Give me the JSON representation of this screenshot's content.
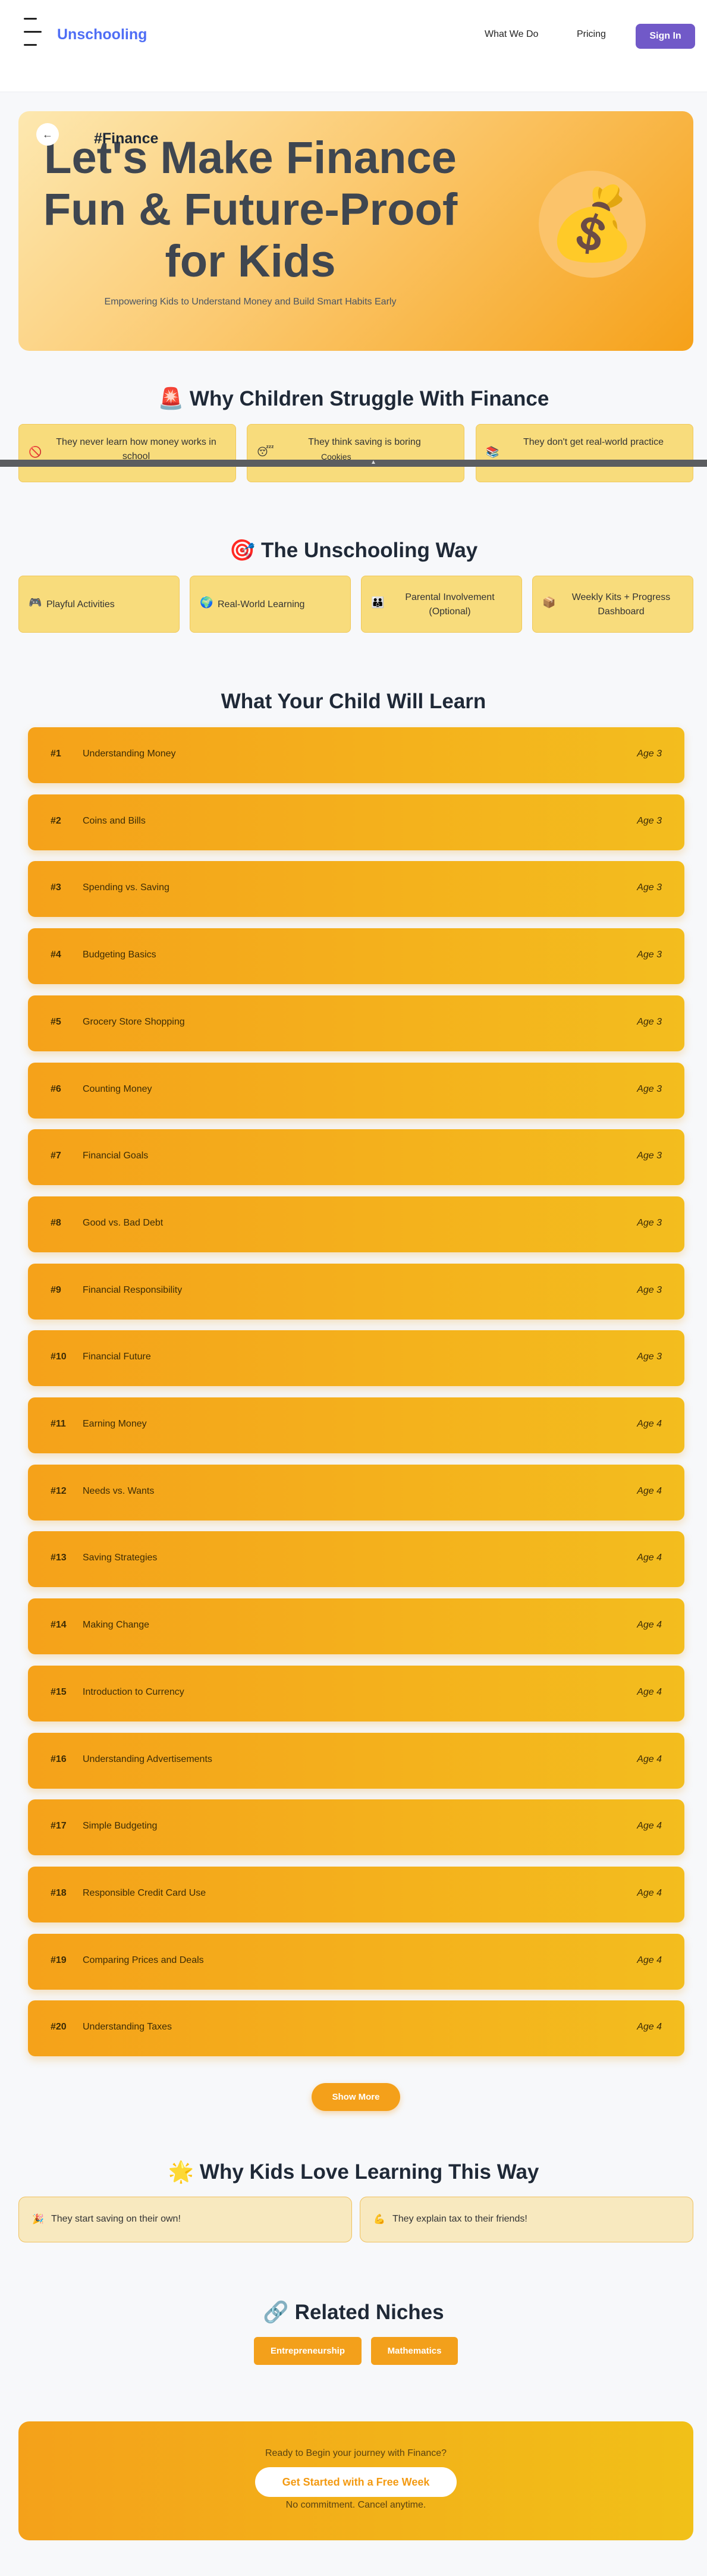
{
  "nav": {
    "brand": "Unschooling",
    "links": [
      "What We Do",
      "Pricing"
    ],
    "signin": "Sign In"
  },
  "hero": {
    "back_icon": "←",
    "tag": "#Finance",
    "title": "Let's Make Finance Fun & Future-Proof for Kids",
    "subtitle": "Empowering Kids to Understand Money and Build Smart Habits Early",
    "icon": "💰"
  },
  "struggle": {
    "title": "🚨 Why Children Struggle With Finance",
    "items": [
      {
        "icon": "🚫",
        "text": "They never learn how money works in school"
      },
      {
        "icon": "😴",
        "text": "They think saving is boring"
      },
      {
        "icon": "📚",
        "text": "They don't get real-world practice"
      }
    ]
  },
  "cookie": {
    "label": "Cookies",
    "chevron": "▲"
  },
  "way": {
    "title": "🎯 The Unschooling Way",
    "items": [
      {
        "icon": "🎮",
        "text": "Playful Activities"
      },
      {
        "icon": "🌍",
        "text": "Real-World Learning"
      },
      {
        "icon": "👪",
        "text": "Parental Involvement (Optional)"
      },
      {
        "icon": "📦",
        "text": "Weekly Kits + Progress Dashboard"
      }
    ]
  },
  "learn": {
    "title": "What Your Child Will Learn",
    "lessons": [
      {
        "num": "#1",
        "name": "Understanding Money",
        "age": "Age 3"
      },
      {
        "num": "#2",
        "name": "Coins and Bills",
        "age": "Age 3"
      },
      {
        "num": "#3",
        "name": "Spending vs. Saving",
        "age": "Age 3"
      },
      {
        "num": "#4",
        "name": "Budgeting Basics",
        "age": "Age 3"
      },
      {
        "num": "#5",
        "name": "Grocery Store Shopping",
        "age": "Age 3"
      },
      {
        "num": "#6",
        "name": "Counting Money",
        "age": "Age 3"
      },
      {
        "num": "#7",
        "name": "Financial Goals",
        "age": "Age 3"
      },
      {
        "num": "#8",
        "name": "Good vs. Bad Debt",
        "age": "Age 3"
      },
      {
        "num": "#9",
        "name": "Financial Responsibility",
        "age": "Age 3"
      },
      {
        "num": "#10",
        "name": "Financial Future",
        "age": "Age 3"
      },
      {
        "num": "#11",
        "name": "Earning Money",
        "age": "Age 4"
      },
      {
        "num": "#12",
        "name": "Needs vs. Wants",
        "age": "Age 4"
      },
      {
        "num": "#13",
        "name": "Saving Strategies",
        "age": "Age 4"
      },
      {
        "num": "#14",
        "name": "Making Change",
        "age": "Age 4"
      },
      {
        "num": "#15",
        "name": "Introduction to Currency",
        "age": "Age 4"
      },
      {
        "num": "#16",
        "name": "Understanding Advertisements",
        "age": "Age 4"
      },
      {
        "num": "#17",
        "name": "Simple Budgeting",
        "age": "Age 4"
      },
      {
        "num": "#18",
        "name": "Responsible Credit Card Use",
        "age": "Age 4"
      },
      {
        "num": "#19",
        "name": "Comparing Prices and Deals",
        "age": "Age 4"
      },
      {
        "num": "#20",
        "name": "Understanding Taxes",
        "age": "Age 4"
      }
    ],
    "show_more": "Show More"
  },
  "love": {
    "title": "🌟 Why Kids Love Learning This Way",
    "items": [
      {
        "icon": "🎉",
        "text": "They start saving on their own!"
      },
      {
        "icon": "💪",
        "text": "They explain tax to their friends!"
      }
    ]
  },
  "related": {
    "title": "🔗 Related Niches",
    "items": [
      "Entrepreneurship",
      "Mathematics"
    ]
  },
  "cta": {
    "question": "Ready to Begin your journey with Finance?",
    "button": "Get Started with a Free Week",
    "note": "No commitment. Cancel anytime."
  }
}
